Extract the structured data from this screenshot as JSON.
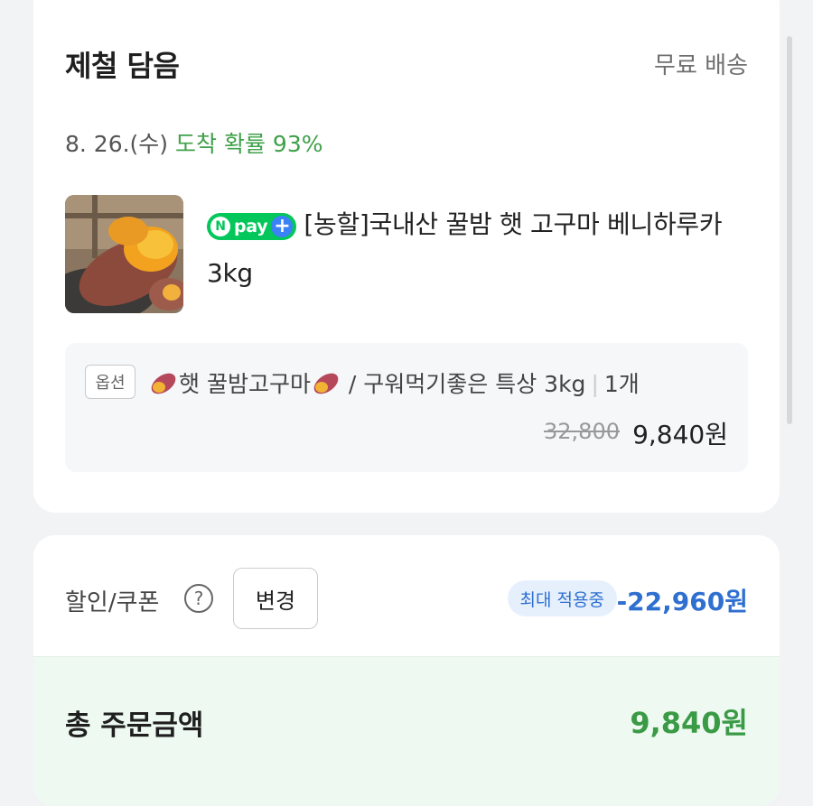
{
  "store": {
    "name": "제철 담음",
    "shipping": "무료 배송",
    "delivery_date": "8. 26.(수)",
    "delivery_probability": "도착 확률 93%"
  },
  "product": {
    "badge": {
      "n": "N",
      "pay": "pay"
    },
    "title": "[농할]국내산 꿀밤 햇 고구마 베니하루카 3kg",
    "image_icon": "sweet-potato-photo"
  },
  "option": {
    "tag": "옵션",
    "name": "햇 꿀밤고구마",
    "detail": "/ 구워먹기좋은 특상 3kg",
    "quantity": "1개",
    "original_price": "32,800",
    "sale_price": "9,840원"
  },
  "discount": {
    "label": "할인/쿠폰",
    "change_button": "변경",
    "badge": "최대 적용중",
    "amount": "-22,960원"
  },
  "total": {
    "label": "총 주문금액",
    "amount": "9,840원"
  },
  "colors": {
    "green": "#3fa14a",
    "blue": "#2f6fd0",
    "npay_green": "#03c75a"
  }
}
